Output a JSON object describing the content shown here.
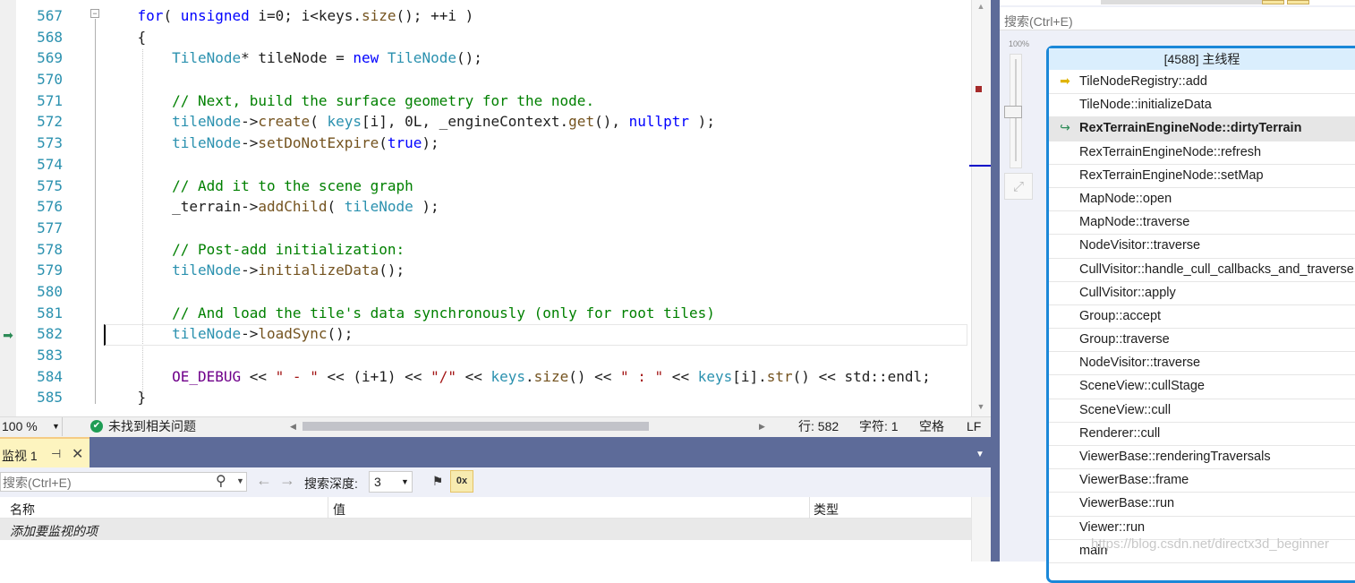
{
  "editor": {
    "line_numbers": [
      "567",
      "568",
      "569",
      "570",
      "571",
      "572",
      "573",
      "574",
      "575",
      "576",
      "577",
      "578",
      "579",
      "580",
      "581",
      "582",
      "583",
      "584",
      "585"
    ],
    "current_line": "582"
  },
  "status_bar": {
    "zoom": "100 %",
    "issues_text": "未找到相关问题",
    "line": "行: 582",
    "column": "字符: 1",
    "whitespace": "空格",
    "line_ending": "LF"
  },
  "watch": {
    "tab_title": "监视 1",
    "search_placeholder": "搜索(Ctrl+E)",
    "depth_label": "搜索深度:",
    "depth_value": "3",
    "columns": [
      "名称",
      "值",
      "类型"
    ],
    "add_item": "添加要监视的项"
  },
  "call_stack": {
    "search_placeholder": "搜索(Ctrl+E)",
    "zoom_label": "100%",
    "thread_title": "[4588] 主线程",
    "frames": [
      {
        "label": "TileNodeRegistry::add",
        "icon": "current-frame-arrow-icon",
        "bold": false,
        "highlighted": false
      },
      {
        "label": "TileNode::initializeData",
        "icon": "",
        "bold": false,
        "highlighted": false
      },
      {
        "label": "RexTerrainEngineNode::dirtyTerrain",
        "icon": "return-arrow-icon",
        "bold": true,
        "highlighted": true
      },
      {
        "label": "RexTerrainEngineNode::refresh",
        "icon": "",
        "bold": false,
        "highlighted": false
      },
      {
        "label": "RexTerrainEngineNode::setMap",
        "icon": "",
        "bold": false,
        "highlighted": false
      },
      {
        "label": "MapNode::open",
        "icon": "",
        "bold": false,
        "highlighted": false
      },
      {
        "label": "MapNode::traverse",
        "icon": "",
        "bold": false,
        "highlighted": false
      },
      {
        "label": "NodeVisitor::traverse",
        "icon": "",
        "bold": false,
        "highlighted": false
      },
      {
        "label": "CullVisitor::handle_cull_callbacks_and_traverse",
        "icon": "",
        "bold": false,
        "highlighted": false
      },
      {
        "label": "CullVisitor::apply",
        "icon": "",
        "bold": false,
        "highlighted": false
      },
      {
        "label": "Group::accept",
        "icon": "",
        "bold": false,
        "highlighted": false
      },
      {
        "label": "Group::traverse",
        "icon": "",
        "bold": false,
        "highlighted": false
      },
      {
        "label": "NodeVisitor::traverse",
        "icon": "",
        "bold": false,
        "highlighted": false
      },
      {
        "label": "SceneView::cullStage",
        "icon": "",
        "bold": false,
        "highlighted": false
      },
      {
        "label": "SceneView::cull",
        "icon": "",
        "bold": false,
        "highlighted": false
      },
      {
        "label": "Renderer::cull",
        "icon": "",
        "bold": false,
        "highlighted": false
      },
      {
        "label": "ViewerBase::renderingTraversals",
        "icon": "",
        "bold": false,
        "highlighted": false
      },
      {
        "label": "ViewerBase::frame",
        "icon": "",
        "bold": false,
        "highlighted": false
      },
      {
        "label": "ViewerBase::run",
        "icon": "",
        "bold": false,
        "highlighted": false
      },
      {
        "label": "Viewer::run",
        "icon": "",
        "bold": false,
        "highlighted": false
      },
      {
        "label": "main",
        "icon": "",
        "bold": false,
        "highlighted": false
      }
    ],
    "watermark": "https://blog.csdn.net/directx3d_beginner"
  },
  "colors": {
    "keyword": "#0000ff",
    "type": "#2b91af",
    "comment": "#008000",
    "function": "#74531f",
    "macro": "#6f008a",
    "string": "#a31515",
    "splitter": "#5d6b99",
    "stack_border": "#1b88d8"
  }
}
